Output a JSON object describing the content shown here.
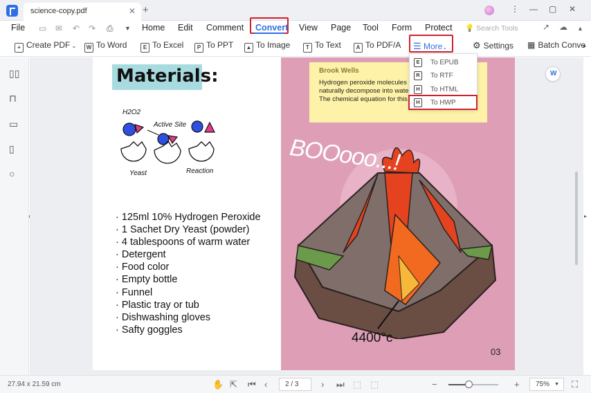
{
  "titlebar": {
    "tab_title": "science-copy.pdf",
    "close_tab": "✕",
    "new_tab": "+",
    "controls": [
      "⋮",
      "—",
      "▢",
      "✕"
    ]
  },
  "menubar": {
    "file": "File",
    "items": [
      "Home",
      "Edit",
      "Comment",
      "Convert",
      "View",
      "Page",
      "Tool",
      "Form",
      "Protect"
    ],
    "active": "Convert",
    "search_placeholder": "Search Tools"
  },
  "toolbar": {
    "create_pdf": "Create PDF",
    "to_word": "To Word",
    "to_excel": "To Excel",
    "to_ppt": "To PPT",
    "to_image": "To Image",
    "to_text": "To Text",
    "to_pdfa": "To PDF/A",
    "more": "More",
    "settings": "Settings",
    "batch_convert": "Batch Conve"
  },
  "dropdown": {
    "items": [
      {
        "icon": "E",
        "label": "To EPUB"
      },
      {
        "icon": "R",
        "label": "To RTF"
      },
      {
        "icon": "H",
        "label": "To HTML"
      },
      {
        "icon": "H",
        "label": "To HWP"
      }
    ],
    "highlighted": "To HWP"
  },
  "document": {
    "materials_title": "Materials:",
    "diagram_labels": {
      "h2o2": "H2O2",
      "active_site": "Active Site",
      "yeast": "Yeast",
      "reaction": "Reaction"
    },
    "materials": [
      "125ml 10% Hydrogen Peroxide",
      "1 Sachet Dry Yeast (powder)",
      "4 tablespoons of warm water",
      "Detergent",
      "Food color",
      "Empty bottle",
      "Funnel",
      "Plastic tray or tub",
      "Dishwashing gloves",
      "Safty goggles"
    ],
    "note_author": "Brook Wells",
    "note_lines": [
      "Hydrogen peroxide molecules a",
      "naturally decompose into wate",
      "The chemical equation for this"
    ],
    "booo_text": "BOOooo...!",
    "temperature": "4400°c",
    "page_number": "03"
  },
  "statusbar": {
    "dimensions": "27.94 x 21.59 cm",
    "page_display": "2 / 3",
    "zoom": "75%",
    "zoom_slider_fraction": 0.4
  },
  "colors": {
    "accent": "#2f6fe4",
    "highlight_red": "#cf2030",
    "page_pink": "#de9eb6",
    "note_yellow": "#fdf2a8",
    "materials_bg": "#a8dbe0"
  }
}
